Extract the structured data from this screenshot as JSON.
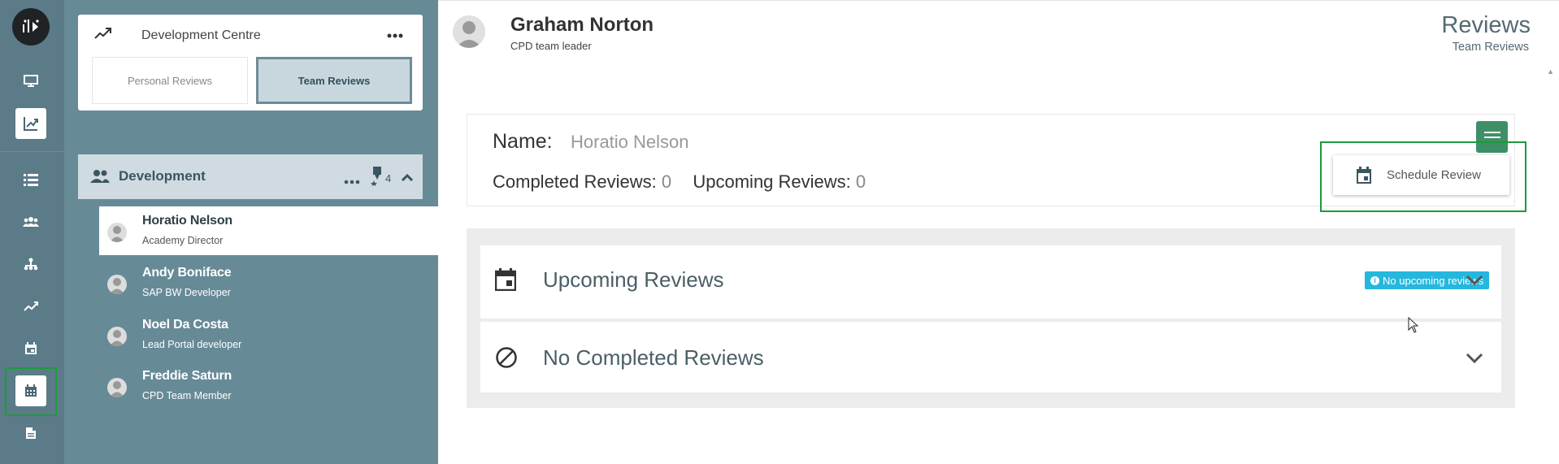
{
  "rail": {
    "icons": [
      "monitor-icon",
      "trend-chart-icon",
      "list-icon",
      "team-icon",
      "sitemap-icon",
      "trend-line-icon",
      "calendar-icon",
      "calendar-grid-icon",
      "document-icon"
    ]
  },
  "panel": {
    "title": "Development Centre",
    "tabs": [
      "Personal Reviews",
      "Team Reviews"
    ],
    "active_tab": "Team Reviews",
    "group": {
      "name": "Development",
      "badge_count": "4"
    },
    "members": [
      {
        "name": "Horatio Nelson",
        "role": "Academy Director",
        "selected": true
      },
      {
        "name": "Andy Boniface",
        "role": "SAP BW Developer"
      },
      {
        "name": "Noel Da Costa",
        "role": "Lead Portal developer"
      },
      {
        "name": "Freddie Saturn",
        "role": "CPD Team Member"
      }
    ]
  },
  "header": {
    "user_name": "Graham Norton",
    "user_role": "CPD team leader",
    "title": "Reviews",
    "subtitle": "Team Reviews"
  },
  "info": {
    "name_label": "Name:",
    "name_value": "Horatio Nelson",
    "completed_label": "Completed Reviews:",
    "completed_value": "0",
    "upcoming_label": "Upcoming Reviews:",
    "upcoming_value": "0"
  },
  "menu": {
    "schedule_label": "Schedule Review"
  },
  "sections": {
    "upcoming_title": "Upcoming Reviews",
    "upcoming_badge": "No upcoming reviews",
    "completed_title": "No Completed Reviews"
  },
  "colors": {
    "rail": "#5b7b88",
    "panel": "#678a97",
    "accent_green": "#3f8f66",
    "badge_blue": "#25b7dd",
    "highlight_green": "#1c9b3b"
  }
}
